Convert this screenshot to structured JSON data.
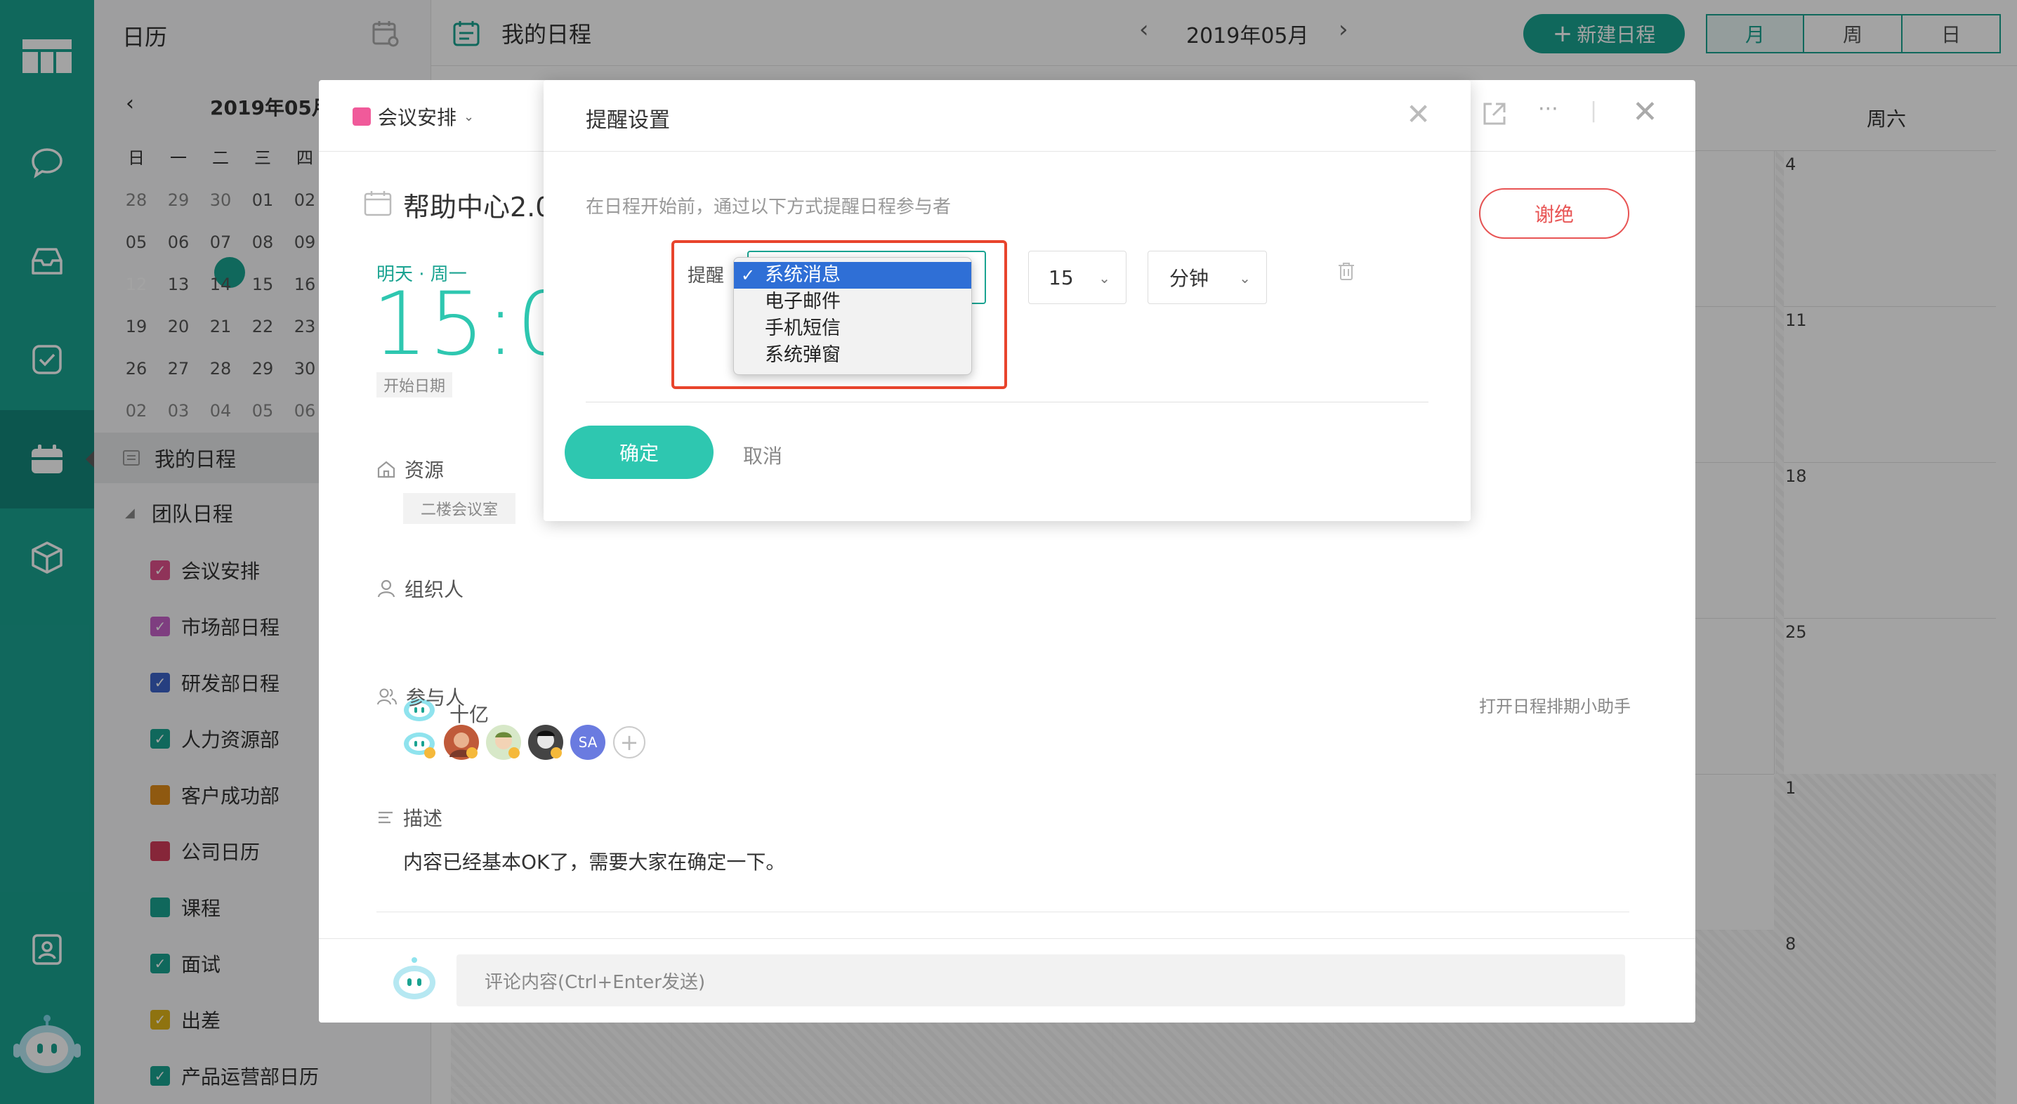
{
  "sidebar": {
    "title": "日历",
    "mini_calendar": {
      "month": "2019年05月",
      "weekdays": [
        "日",
        "一",
        "二",
        "三",
        "四"
      ],
      "rows": [
        [
          "28",
          "29",
          "30",
          "01",
          "02"
        ],
        [
          "05",
          "06",
          "07",
          "08",
          "09"
        ],
        [
          "12",
          "13",
          "14",
          "15",
          "16"
        ],
        [
          "19",
          "20",
          "21",
          "22",
          "23"
        ],
        [
          "26",
          "27",
          "28",
          "29",
          "30"
        ],
        [
          "02",
          "03",
          "04",
          "05",
          "06"
        ]
      ]
    },
    "my_schedule": "我的日程",
    "team_schedule": "团队日程",
    "teams": [
      {
        "label": "会议安排",
        "color": "#e0508c",
        "checked": true
      },
      {
        "label": "市场部日程",
        "color": "#c561c9",
        "checked": true
      },
      {
        "label": "研发部日程",
        "color": "#3c63c9",
        "checked": true
      },
      {
        "label": "人力资源部",
        "color": "#1aa391",
        "checked": true
      },
      {
        "label": "客户成功部",
        "color": "#e08c1a",
        "checked": false
      },
      {
        "label": "公司日历",
        "color": "#d23c5a",
        "checked": false
      },
      {
        "label": "课程",
        "color": "#1aa391",
        "checked": false
      },
      {
        "label": "面试",
        "color": "#1aa391",
        "checked": true
      },
      {
        "label": "出差",
        "color": "#e0b41a",
        "checked": true
      },
      {
        "label": "产品运营部日历",
        "color": "#1aa391",
        "checked": true
      }
    ]
  },
  "header": {
    "title": "我的日程",
    "month": "2019年05月",
    "new_button": "新建日程",
    "views": [
      "月",
      "周",
      "日"
    ]
  },
  "calendar": {
    "visible_header": "周六",
    "saturday_dates": [
      "4",
      "11",
      "18",
      "25",
      "1",
      "8"
    ]
  },
  "event": {
    "category": "会议安排",
    "title": "帮助中心2.0",
    "day": "明天 · 周一",
    "time": "15:00",
    "start_label": "开始日期",
    "decline": "谢绝",
    "resource_label": "资源",
    "resource_value": "二楼会议室",
    "organizer_label": "组织人",
    "organizer_name": "十亿",
    "participants_label": "参与人",
    "helper_link": "打开日程排期小助手",
    "participant_sa": "SA",
    "description_label": "描述",
    "description": "内容已经基本OK了，需要大家在确定一下。",
    "comment_placeholder": "评论内容(Ctrl+Enter发送)"
  },
  "reminder": {
    "title": "提醒设置",
    "hint": "在日程开始前，通过以下方式提醒日程参与者",
    "label": "提醒",
    "options": [
      "系统消息",
      "电子邮件",
      "手机短信",
      "系统弹窗"
    ],
    "selected_option": "系统消息",
    "amount": "15",
    "unit": "分钟",
    "confirm": "确定",
    "cancel": "取消"
  },
  "colors": {
    "brand": "#1aa391",
    "accent": "#2ec7b0",
    "danger": "#e85454",
    "highlight": "#e8442c",
    "select_blue": "#2f6fd6"
  }
}
